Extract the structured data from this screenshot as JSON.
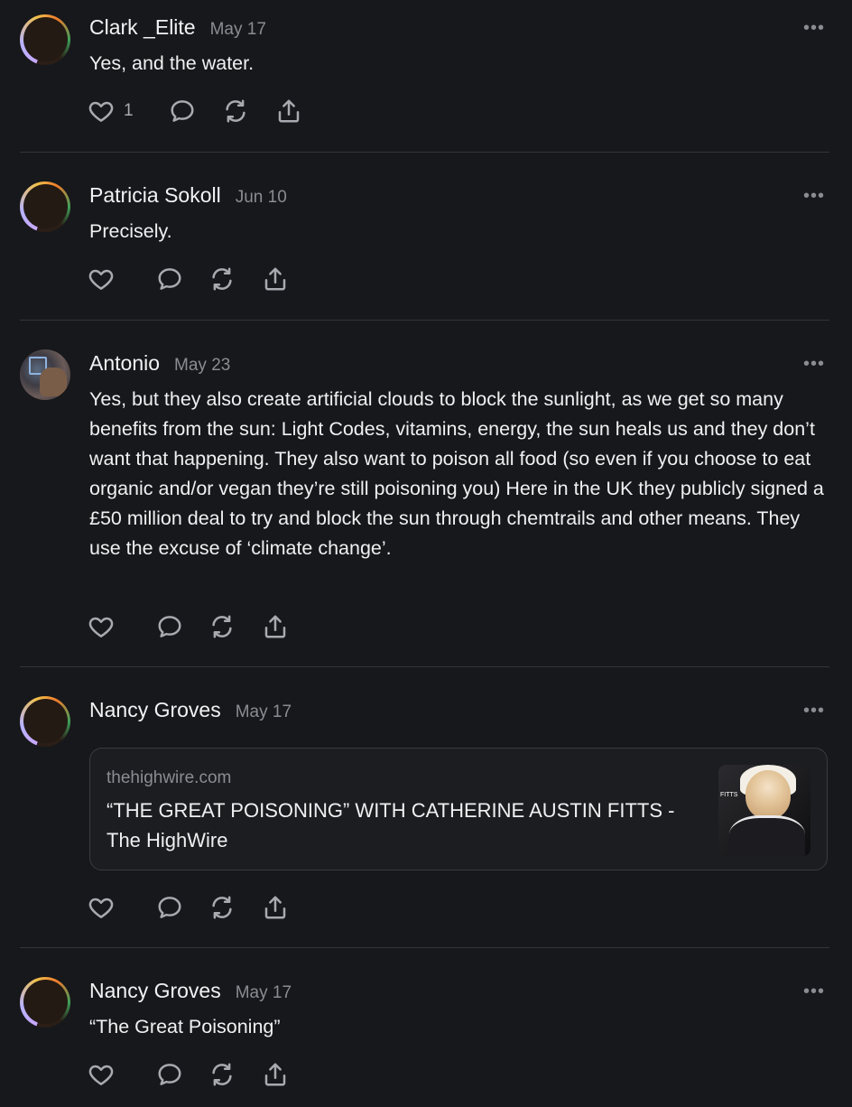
{
  "comments": [
    {
      "author": "Clark _Elite",
      "date": "May 17",
      "text": "Yes, and the water.",
      "likes": "1",
      "avatar_icon": "ring-avatar"
    },
    {
      "author": "Patricia Sokoll",
      "date": "Jun 10",
      "text": "Precisely.",
      "likes": "",
      "avatar_icon": "ring-avatar"
    },
    {
      "author": "Antonio",
      "date": "May 23",
      "text": "Yes, but they also create artificial clouds to block the sunlight, as we get so many benefits from the sun: Light Codes, vitamins, energy, the sun heals us and they don’t want that happening. They also want to poison all food (so even if you choose to eat organic and/or vegan they’re still poisoning you) Here in the UK they publicly signed a £50 million deal to try and block the sun through chemtrails and other means. They use the excuse of ‘climate change’.",
      "likes": "",
      "avatar_icon": "photo-avatar"
    },
    {
      "author": "Nancy Groves",
      "date": "May 17",
      "link": {
        "domain": "thehighwire.com",
        "title": "“THE GREAT POISONING” WITH CATHERINE AUSTIN FITTS - The HighWire",
        "thumb_tag": "FITTS"
      },
      "likes": "",
      "avatar_icon": "ring-avatar"
    },
    {
      "author": "Nancy Groves",
      "date": "May 17",
      "text": "“The Great Poisoning”",
      "likes": "",
      "avatar_icon": "ring-avatar"
    }
  ],
  "more_glyph": "•••",
  "icons": [
    "heart-icon",
    "reply-icon",
    "restack-icon",
    "share-icon",
    "more-icon"
  ]
}
